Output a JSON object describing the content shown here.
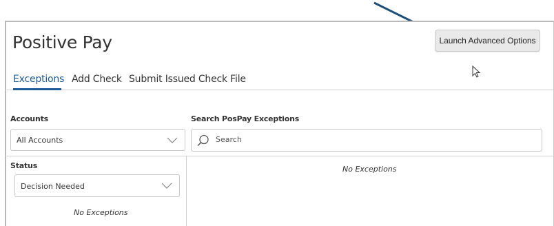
{
  "page": {
    "title": "Positive Pay"
  },
  "header": {
    "advanced_button_label": "Launch Advanced Options"
  },
  "tabs": [
    {
      "label": "Exceptions",
      "active": true
    },
    {
      "label": "Add Check",
      "active": false
    },
    {
      "label": "Submit Issued Check File",
      "active": false
    }
  ],
  "filters": {
    "accounts_label": "Accounts",
    "accounts_value": "All Accounts",
    "search_label": "Search PosPay Exceptions",
    "search_placeholder": "Search",
    "status_label": "Status",
    "status_value": "Decision Needed"
  },
  "messages": {
    "left_empty": "No Exceptions",
    "right_empty": "No Exceptions"
  },
  "icons": {
    "search": "search-icon",
    "chevron": "chevron-down-icon",
    "arrow": "annotation-arrow-icon",
    "cursor": "mouse-cursor-icon"
  },
  "colors": {
    "accent": "#1e5a96",
    "arrow": "#1f4e79",
    "button_bg": "#e9e9e9"
  }
}
